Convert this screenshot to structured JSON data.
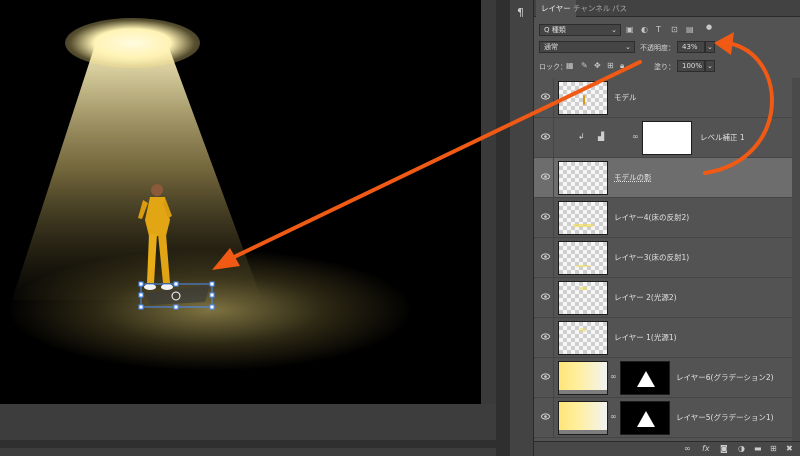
{
  "tabs": [
    {
      "label": "レイヤー",
      "active": true
    },
    {
      "label": "チャンネル",
      "active": false
    },
    {
      "label": "パス",
      "active": false
    }
  ],
  "icon_strip": {
    "paragraph_icon": "¶"
  },
  "filter": {
    "kind_label": "Q 種類"
  },
  "blend": {
    "mode": "通常",
    "opacity_label": "不透明度：",
    "opacity_value": "43%"
  },
  "lock": {
    "label": "ロック：",
    "fill_label": "塗り：",
    "fill_value": "100%"
  },
  "layers": [
    {
      "name": "モデル",
      "thumb": "model",
      "selected": false
    },
    {
      "name": "レベル補正 1",
      "thumb": "adjustment",
      "selected": false
    },
    {
      "name": "モデルの影",
      "thumb": "shadow",
      "selected": true
    },
    {
      "name": "レイヤー4(床の反射2)",
      "thumb": "floor2",
      "selected": false
    },
    {
      "name": "レイヤー3(床の反射1)",
      "thumb": "floor1",
      "selected": false
    },
    {
      "name": "レイヤー 2(光源2)",
      "thumb": "light2",
      "selected": false
    },
    {
      "name": "レイヤー 1(光源1)",
      "thumb": "light1",
      "selected": false
    },
    {
      "name": "レイヤー6(グラデーション2)",
      "thumb": "gradient-mask",
      "selected": false
    },
    {
      "name": "レイヤー5(グラデーション1)",
      "thumb": "gradient-mask",
      "selected": false
    }
  ],
  "bottom_icons": [
    "link-icon",
    "fx-icon",
    "mask-icon",
    "adjustment-icon",
    "folder-icon",
    "new-layer-icon",
    "trash-icon"
  ],
  "fx_text": "fx",
  "colors": {
    "accent_arrow": "#f05a14",
    "spotlight": "#fff3b5",
    "panel_bg": "#535353",
    "selected_row": "#6d6d6d"
  }
}
